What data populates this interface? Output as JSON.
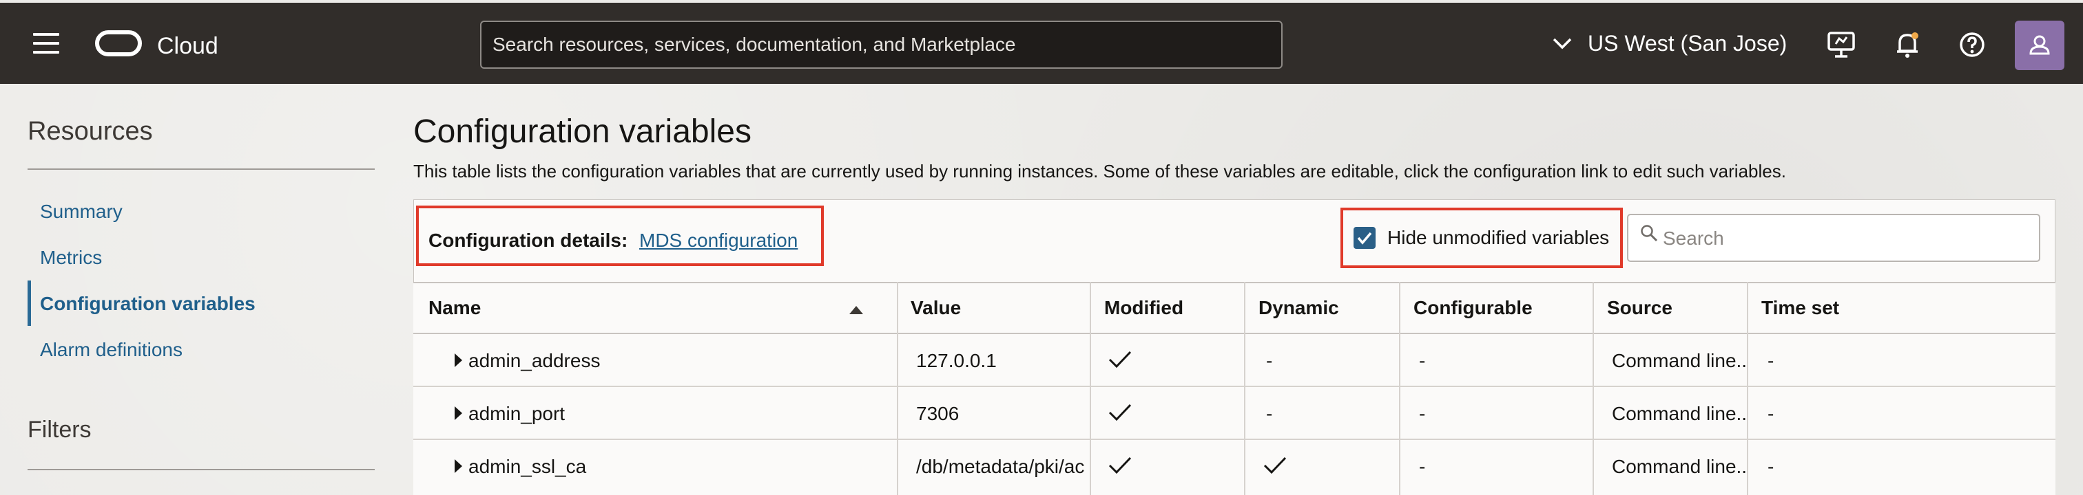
{
  "header": {
    "brand": "Cloud",
    "search_placeholder": "Search resources, services, documentation, and Marketplace",
    "region": "US West (San Jose)",
    "icons": [
      "menu-icon",
      "oracle-logo",
      "chevron-down-icon",
      "console-icon",
      "bell-icon",
      "help-icon",
      "avatar"
    ]
  },
  "sidebar": {
    "resources_title": "Resources",
    "items": [
      {
        "label": "Summary",
        "active": false
      },
      {
        "label": "Metrics",
        "active": false
      },
      {
        "label": "Configuration variables",
        "active": true
      },
      {
        "label": "Alarm definitions",
        "active": false
      }
    ],
    "filters_title": "Filters"
  },
  "main": {
    "title": "Configuration variables",
    "description": "This table lists the configuration variables that are currently used by running instances. Some of these variables are editable, click the configuration link to edit such variables.",
    "config_label": "Configuration details:",
    "config_link": "MDS configuration",
    "hide_unmodified_label": "Hide unmodified variables",
    "hide_unmodified_checked": true,
    "search_placeholder": "Search",
    "columns": [
      "Name",
      "Value",
      "Modified",
      "Dynamic",
      "Configurable",
      "Source",
      "Time set"
    ],
    "rows": [
      {
        "name": "admin_address",
        "value": "127.0.0.1",
        "modified": true,
        "dynamic": "-",
        "configurable": "-",
        "source": "Command line..",
        "time_set": "-"
      },
      {
        "name": "admin_port",
        "value": "7306",
        "modified": true,
        "dynamic": "-",
        "configurable": "-",
        "source": "Command line..",
        "time_set": "-"
      },
      {
        "name": "admin_ssl_ca",
        "value": "/db/metadata/pki/ac",
        "modified": true,
        "dynamic": true,
        "configurable": "-",
        "source": "Command line..",
        "time_set": "-"
      }
    ]
  },
  "colors": {
    "header_bg": "#312d2a",
    "link": "#1f5f8b",
    "highlight_border": "#e03a2a",
    "checkbox": "#2a5f87"
  }
}
